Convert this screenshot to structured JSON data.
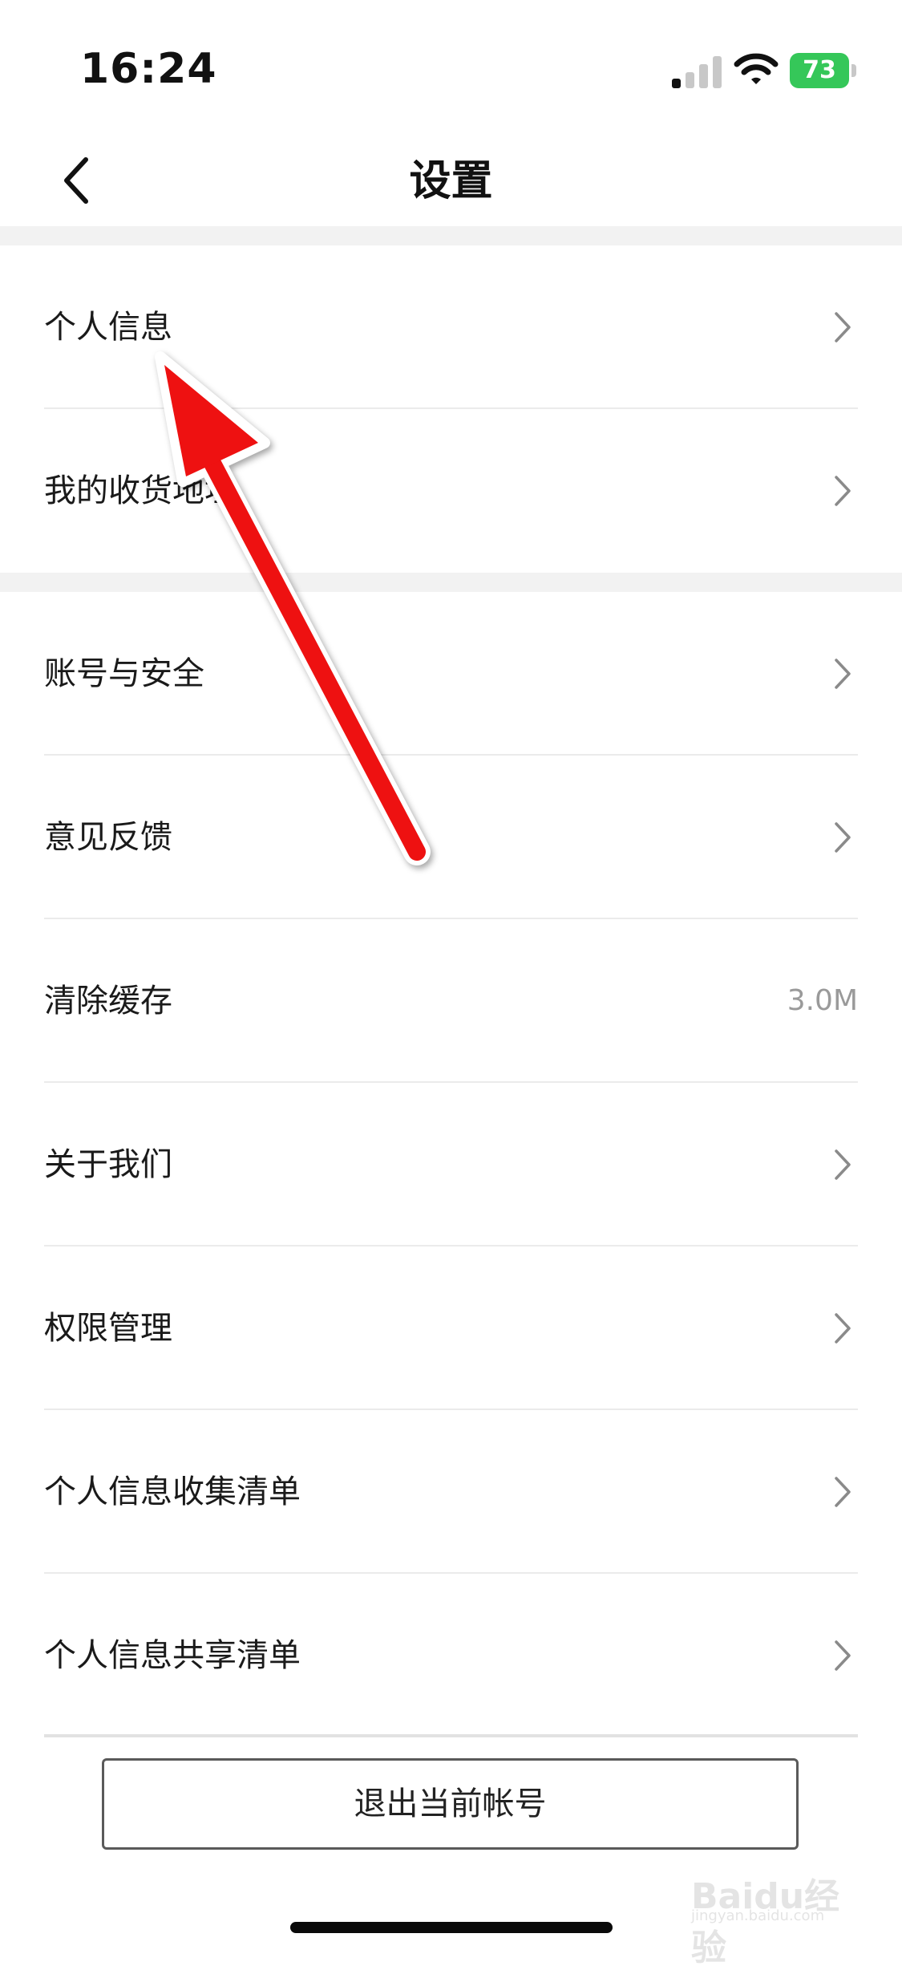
{
  "status_bar": {
    "time": "16:24",
    "battery_level": "73",
    "battery_color": "#35c759"
  },
  "nav": {
    "title": "设置",
    "back_icon": "chevron-left-icon"
  },
  "settings_groups": [
    {
      "items": [
        {
          "label": "个人信息",
          "type": "link"
        },
        {
          "label": "我的收货地址",
          "type": "link"
        }
      ]
    },
    {
      "items": [
        {
          "label": "账号与安全",
          "type": "link"
        },
        {
          "label": "意见反馈",
          "type": "link"
        },
        {
          "label": "清除缓存",
          "type": "value",
          "value": "3.0M"
        },
        {
          "label": "关于我们",
          "type": "link"
        },
        {
          "label": "权限管理",
          "type": "link"
        },
        {
          "label": "个人信息收集清单",
          "type": "link"
        },
        {
          "label": "个人信息共享清单",
          "type": "link"
        }
      ]
    }
  ],
  "logout_label": "退出当前帐号",
  "annotation": {
    "icon": "red-arrow-icon",
    "color": "#ee1111"
  },
  "watermark": {
    "brand": "Baidu经验",
    "url": "jingyan.baidu.com"
  }
}
